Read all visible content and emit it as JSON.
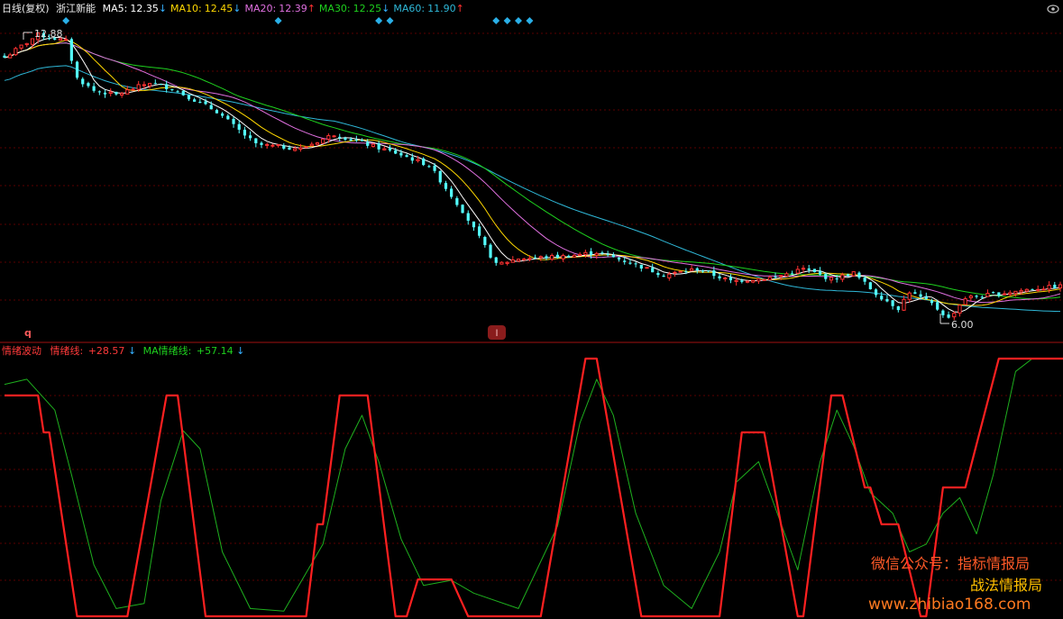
{
  "header": {
    "period_label": "日线(复权)",
    "stock_name": "浙江新能",
    "ma": [
      {
        "label": "MA5:",
        "value": "12.35",
        "arrow": "↓",
        "color": "#ffffff",
        "arrow_color": "#35b0ff"
      },
      {
        "label": "MA10:",
        "value": "12.45",
        "arrow": "↓",
        "color": "#ffd800",
        "arrow_color": "#35b0ff"
      },
      {
        "label": "MA20:",
        "value": "12.39",
        "arrow": "↑",
        "color": "#e070e0",
        "arrow_color": "#ff3030"
      },
      {
        "label": "MA30:",
        "value": "12.25",
        "arrow": "↓",
        "color": "#1ed01e",
        "arrow_color": "#35b0ff"
      },
      {
        "label": "MA60:",
        "value": "11.90",
        "arrow": "↑",
        "color": "#2fb8d8",
        "arrow_color": "#ff3030"
      }
    ]
  },
  "indicator_header": {
    "name": "情绪波动",
    "line_label": "情绪线:",
    "line_value": "+28.57",
    "line_arrow": "↓",
    "ma_label": "MA情绪线:",
    "ma_value": "+57.14",
    "ma_arrow": "↓"
  },
  "annotations": {
    "high_price": "12.88",
    "low_price": "6.00",
    "marker_left": "q",
    "marker_mid": "l"
  },
  "watermark": {
    "line1": "微信公众号：指标情报局",
    "line2": "战法情报局",
    "line3": "www.zhibiao168.com"
  },
  "colors": {
    "up": "#ff3232",
    "down": "#54ffff",
    "grid": "#5a0000",
    "emotion_line": "#ff2020",
    "emotion_ma": "#1eb01e",
    "diamond": "#2ab0e8"
  },
  "chart_data": [
    {
      "type": "candlestick",
      "title": "",
      "ylim": [
        5.6,
        13.3
      ],
      "price_high": 12.88,
      "price_low": 6.0,
      "num_bars": 190,
      "series": [
        {
          "name": "MA5",
          "value": 12.35
        },
        {
          "name": "MA10",
          "value": 12.45
        },
        {
          "name": "MA20",
          "value": 12.39
        },
        {
          "name": "MA30",
          "value": 12.25
        },
        {
          "name": "MA60",
          "value": 11.9
        }
      ],
      "diamond_markers_bar_index": [
        11,
        49,
        67,
        69,
        88,
        90,
        92,
        94
      ],
      "price_path_keypoints": [
        [
          0,
          12.3
        ],
        [
          6,
          12.85
        ],
        [
          11,
          12.7
        ],
        [
          13,
          11.8
        ],
        [
          16,
          11.5
        ],
        [
          20,
          11.4
        ],
        [
          26,
          11.7
        ],
        [
          30,
          11.55
        ],
        [
          38,
          11.0
        ],
        [
          45,
          10.2
        ],
        [
          53,
          10.1
        ],
        [
          59,
          10.45
        ],
        [
          65,
          10.2
        ],
        [
          70,
          10.0
        ],
        [
          76,
          9.7
        ],
        [
          82,
          8.6
        ],
        [
          88,
          7.3
        ],
        [
          92,
          7.45
        ],
        [
          100,
          7.5
        ],
        [
          106,
          7.6
        ],
        [
          112,
          7.35
        ],
        [
          118,
          7.05
        ],
        [
          124,
          7.2
        ],
        [
          130,
          6.9
        ],
        [
          138,
          7.0
        ],
        [
          143,
          7.2
        ],
        [
          148,
          6.95
        ],
        [
          152,
          7.1
        ],
        [
          156,
          6.6
        ],
        [
          160,
          6.25
        ],
        [
          162,
          6.65
        ],
        [
          166,
          6.35
        ],
        [
          169,
          6.0
        ],
        [
          172,
          6.5
        ],
        [
          178,
          6.6
        ],
        [
          184,
          6.72
        ],
        [
          189,
          6.78
        ]
      ]
    },
    {
      "type": "line",
      "title": "情绪波动",
      "ylim": [
        0,
        100
      ],
      "series": [
        {
          "name": "情绪线",
          "points": [
            [
              0,
              85.7
            ],
            [
              6,
              85.7
            ],
            [
              7,
              71.4
            ],
            [
              8,
              71.4
            ],
            [
              13,
              0
            ],
            [
              22,
              0
            ],
            [
              29,
              85.7
            ],
            [
              31,
              85.7
            ],
            [
              36,
              0
            ],
            [
              54,
              0
            ],
            [
              56,
              35.7
            ],
            [
              57,
              35.7
            ],
            [
              60,
              85.7
            ],
            [
              65,
              85.7
            ],
            [
              70,
              0
            ],
            [
              72,
              0
            ],
            [
              74,
              14.3
            ],
            [
              80,
              14.3
            ],
            [
              83,
              0
            ],
            [
              96,
              0
            ],
            [
              104,
              100
            ],
            [
              106,
              100
            ],
            [
              114,
              0
            ],
            [
              128,
              0
            ],
            [
              132,
              71.4
            ],
            [
              136,
              71.4
            ],
            [
              142,
              0
            ],
            [
              143,
              0
            ],
            [
              148,
              85.7
            ],
            [
              150,
              85.7
            ],
            [
              154,
              50
            ],
            [
              155,
              50
            ],
            [
              157,
              35.7
            ],
            [
              160,
              35.7
            ],
            [
              164,
              0
            ],
            [
              165,
              0
            ],
            [
              168,
              50
            ],
            [
              172,
              50
            ],
            [
              178,
              100
            ],
            [
              190,
              100
            ]
          ]
        },
        {
          "name": "MA情绪线",
          "points": [
            [
              0,
              90
            ],
            [
              4,
              92
            ],
            [
              9,
              80
            ],
            [
              12,
              55
            ],
            [
              16,
              20
            ],
            [
              20,
              3
            ],
            [
              25,
              5
            ],
            [
              28,
              45
            ],
            [
              32,
              72
            ],
            [
              35,
              65
            ],
            [
              39,
              25
            ],
            [
              44,
              3
            ],
            [
              50,
              2
            ],
            [
              57,
              28
            ],
            [
              61,
              65
            ],
            [
              64,
              78
            ],
            [
              67,
              60
            ],
            [
              71,
              30
            ],
            [
              75,
              12
            ],
            [
              80,
              14
            ],
            [
              84,
              9
            ],
            [
              92,
              3
            ],
            [
              99,
              35
            ],
            [
              103,
              75
            ],
            [
              106,
              92
            ],
            [
              109,
              78
            ],
            [
              113,
              40
            ],
            [
              118,
              12
            ],
            [
              123,
              3
            ],
            [
              128,
              25
            ],
            [
              131,
              52
            ],
            [
              135,
              60
            ],
            [
              139,
              36
            ],
            [
              142,
              18
            ],
            [
              146,
              60
            ],
            [
              149,
              80
            ],
            [
              152,
              66
            ],
            [
              155,
              48
            ],
            [
              159,
              40
            ],
            [
              162,
              25
            ],
            [
              165,
              28
            ],
            [
              168,
              40
            ],
            [
              171,
              46
            ],
            [
              174,
              32
            ],
            [
              177,
              55
            ],
            [
              181,
              95
            ],
            [
              184,
              100
            ],
            [
              190,
              100
            ]
          ]
        }
      ]
    }
  ]
}
